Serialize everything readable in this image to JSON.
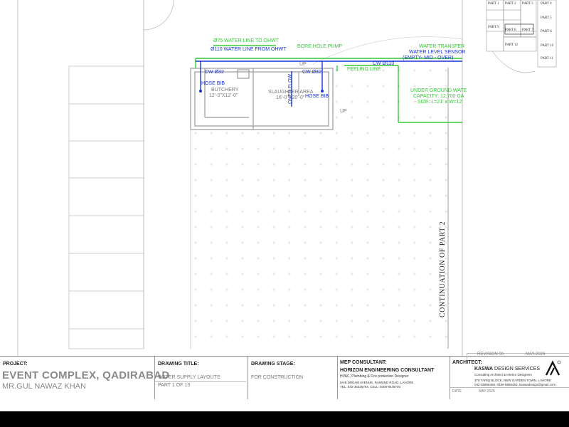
{
  "labels": {
    "water_line_ohwt": "Ø75 WATER LINE TO OHWT",
    "water_line_from_ohwt": "Ø110 WATER LINE FROM OHWT",
    "bore_hole_pump": "BORE HOLE PUMP",
    "cw32_left": "CW Ø32",
    "cw32_right": "CW Ø32",
    "hose_bib_left": "HOSE BIB",
    "hose_bib_right": "HOSE BIB",
    "butchery": "BUTCHERY",
    "butchery_size": "12'-0\"X12'-0\"",
    "slaughter_area": "SLAUGHTER AREA",
    "slaughter_size": "16'-0\"X20'-0\"",
    "over_flow": "OVER FLOW",
    "up_top": "UP",
    "up_right": "UP",
    "cw110": "CW Ø110",
    "feeling_line": "FEELING LINE",
    "water_transfer": "WATER TRANSFER",
    "water_level_sensor": "WATER LEVEL SENSOR",
    "sensor_levels": "(EMPTY- MID - OVER)",
    "ug_water": "UNDER GROUND WATE",
    "capacity": "CAPACITY: 12,700 GA",
    "size": "SIZE: L=21' x W=12'",
    "continuation": "CONTINUATION OF PART 2"
  },
  "key_plan": {
    "parts": [
      "PART 1",
      "PART 2",
      "PART 3",
      "PART 4",
      "PART 5",
      "PART 6",
      "PART 7",
      "PART 8",
      "PART 9",
      "PART 10",
      "PART 11",
      "PART 12"
    ]
  },
  "title_block": {
    "project_head": "PROJECT:",
    "project_name": "EVENT COMPLEX, QADIRABAD",
    "client": "MR.GUL NAWAZ KHAN",
    "drawing_title_head": "DRAWING TITLE:",
    "drawing_title": "WATER SUPPLY LAYOUTS",
    "part": "PART 1 OF 13",
    "stage_head": "DRAWING STAGE:",
    "stage": "FOR CONSTRUCTION",
    "mep_head": "MEP CONSULTANT:",
    "mep_name": "HORIZON ENGINEERING CONSULTANT",
    "mep_sub": "HVAC, Plumbing & Fire protection Designer",
    "mep_addr": "94-B DREAM AVENUE, RAIWIND ROAD, LAHORE",
    "mep_tel": "TEL: 042-35325794, CELL: 0300-8446700",
    "architect_head": "ARCHITECT:",
    "arch_name_bold": "KASWA",
    "arch_name_rest": " DESIGN SERVICES",
    "arch_sub": "Consulting Architect & Interior Designers",
    "arch_addr": "379 TARIQ BLOCK, NEW GARDEN TOWN, LAHORE",
    "arch_tel": "042-35856456, 0336-5856450, kaswadesign@gmail.com",
    "revision": "REVISION 00",
    "revision_date": "MAY-2026",
    "date_label": "DATE",
    "date_value": "MAY-2026"
  },
  "colors": {
    "green": "#33cc33",
    "blue": "#1a33d6",
    "black": "#000000"
  }
}
